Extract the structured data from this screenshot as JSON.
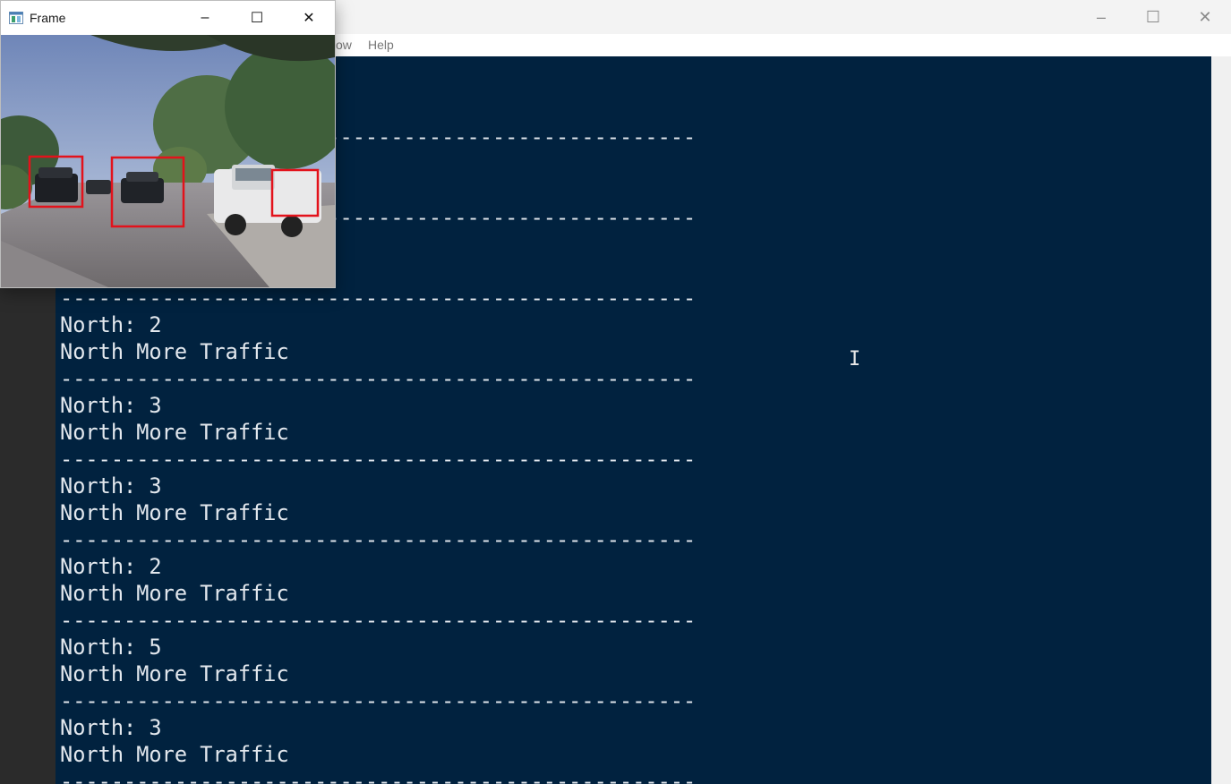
{
  "shell": {
    "menu": [
      "ow",
      "Help"
    ],
    "controls": {
      "minimize": "–",
      "maximize": "☐",
      "close": "✕"
    }
  },
  "console": {
    "divider": "--------------------------------------------------",
    "entries": [
      {
        "count_line": "North: 2",
        "status": "North More Traffic"
      },
      {
        "count_line": "North: 3",
        "status": "North More Traffic"
      },
      {
        "count_line": "North: 3",
        "status": "North More Traffic"
      },
      {
        "count_line": "North: 2",
        "status": "North More Traffic"
      },
      {
        "count_line": "North: 5",
        "status": "North More Traffic"
      },
      {
        "count_line": "North: 3",
        "status": "North More Traffic"
      }
    ]
  },
  "frame": {
    "title": "Frame",
    "controls": {
      "minimize": "–",
      "maximize": "☐",
      "close": "✕"
    },
    "icon": "app-window-icon",
    "image_alt": "traffic camera view with vehicle detections",
    "detection_color": "#e3121b"
  },
  "colors": {
    "console_bg": "#01223f",
    "console_fg": "#e3e8ee"
  }
}
